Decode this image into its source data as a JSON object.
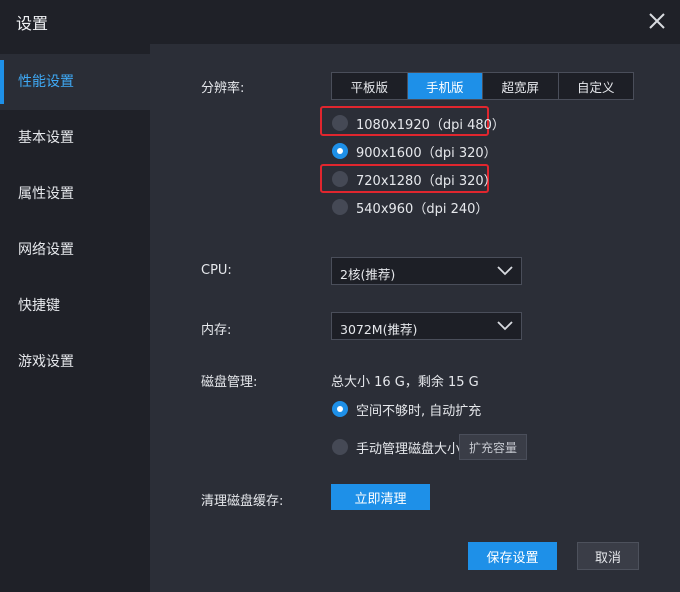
{
  "window": {
    "title": "设置",
    "close_icon": "close-icon"
  },
  "sidebar": {
    "items": [
      {
        "label": "性能设置",
        "active": true
      },
      {
        "label": "基本设置"
      },
      {
        "label": "属性设置"
      },
      {
        "label": "网络设置"
      },
      {
        "label": "快捷键"
      },
      {
        "label": "游戏设置"
      }
    ]
  },
  "resolution": {
    "label": "分辨率:",
    "tabs": [
      "平板版",
      "手机版",
      "超宽屏",
      "自定义"
    ],
    "active_tab": "手机版",
    "options": [
      {
        "label": "1080x1920（dpi 480）",
        "selected": false,
        "highlighted": true
      },
      {
        "label": "900x1600（dpi 320）",
        "selected": true
      },
      {
        "label": "720x1280（dpi 320）",
        "selected": false,
        "highlighted": true
      },
      {
        "label": "540x960（dpi 240）",
        "selected": false
      }
    ]
  },
  "cpu": {
    "label": "CPU:",
    "value": "2核(推荐)"
  },
  "memory": {
    "label": "内存:",
    "value": "3072M(推荐)"
  },
  "disk": {
    "label": "磁盘管理:",
    "summary": "总大小 16 G，剩余 15 G",
    "auto_option": "空间不够时, 自动扩充",
    "auto_selected": true,
    "manual_option": "手动管理磁盘大小",
    "expand_button": "扩充容量"
  },
  "cache": {
    "label": "清理磁盘缓存:",
    "button": "立即清理"
  },
  "footer": {
    "save": "保存设置",
    "cancel": "取消"
  },
  "colors": {
    "accent": "#1e90e8",
    "highlight": "#e0262e",
    "panel": "#2b2e37",
    "sidebar": "#1f2128"
  }
}
